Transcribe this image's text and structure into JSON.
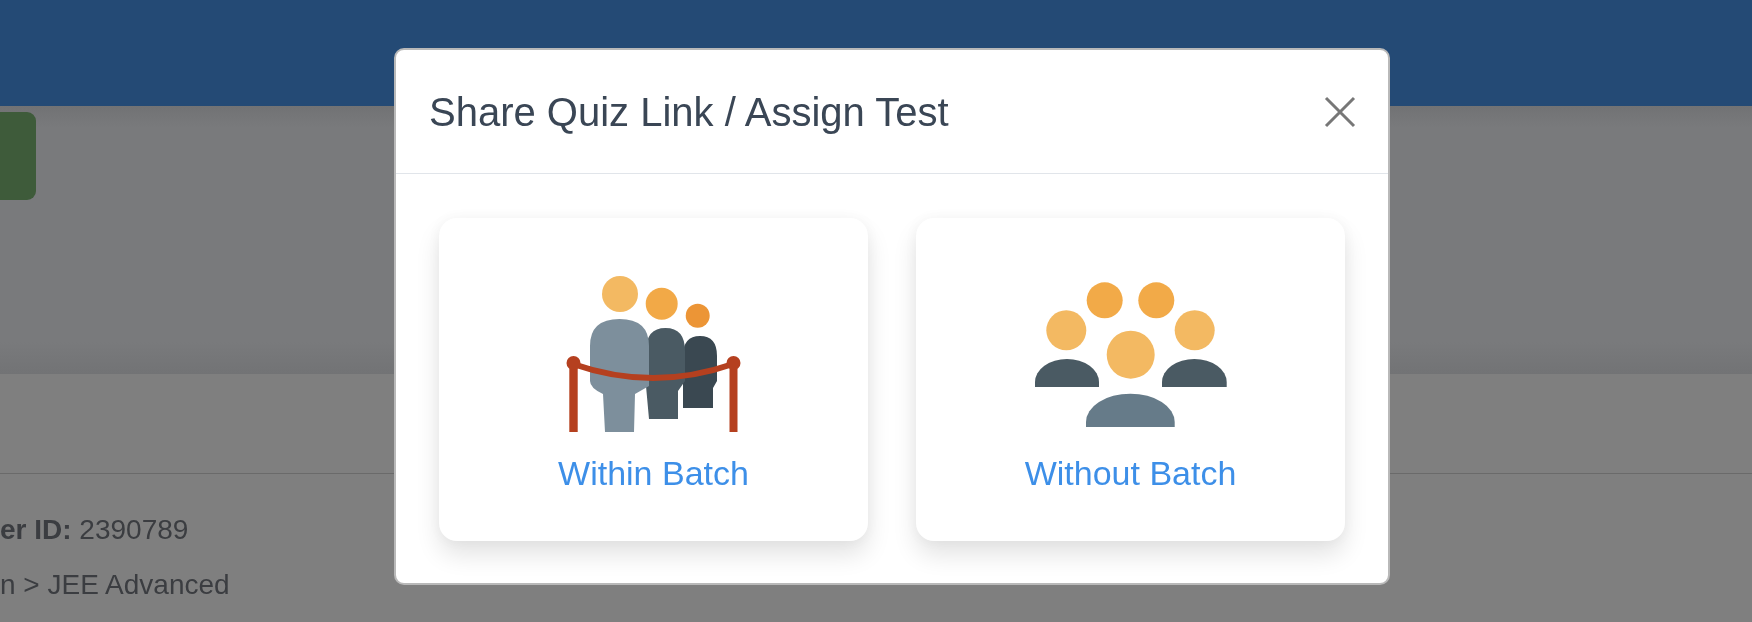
{
  "page": {
    "info_lines": [
      "**er ID:** 2390789",
      "n > JEE Advanced"
    ]
  },
  "dialog": {
    "title": "Share Quiz Link / Assign Test",
    "options": [
      {
        "kind": "within_batch",
        "label": "Within Batch"
      },
      {
        "kind": "without_batch",
        "label": "Without Batch"
      }
    ]
  }
}
